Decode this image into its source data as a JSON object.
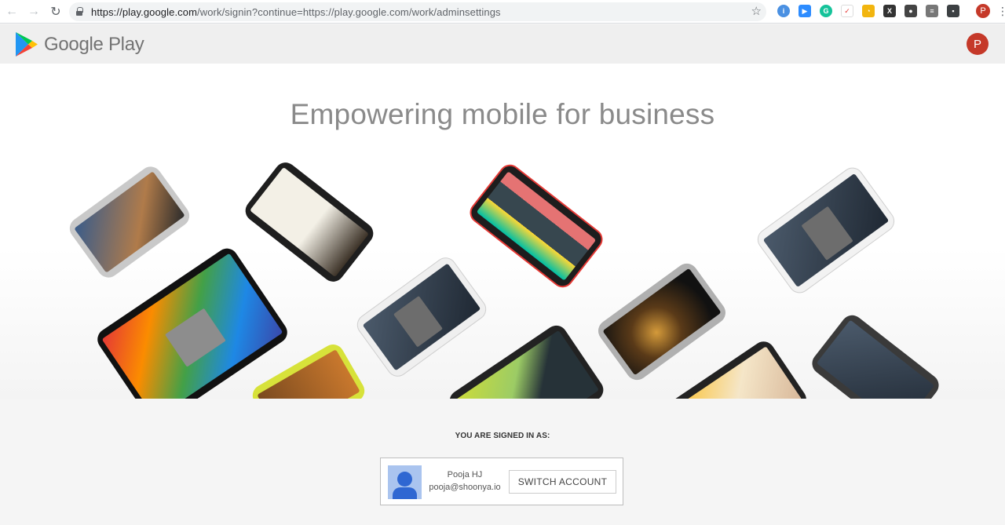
{
  "browser": {
    "url_host": "https://play.google.com",
    "url_path": "/work/signin?continue=https://play.google.com/work/adminsettings",
    "profile_initial": "P",
    "extensions": [
      {
        "icon": "info-extension-icon",
        "color": "#4a90e2",
        "glyph": "i"
      },
      {
        "icon": "zoom-extension-icon",
        "color": "#2d8cff",
        "glyph": "▶"
      },
      {
        "icon": "grammarly-extension-icon",
        "color": "#15c39a",
        "glyph": "G"
      },
      {
        "icon": "todo-extension-icon",
        "color": "#ffffff",
        "glyph": "✓"
      },
      {
        "icon": "clock-extension-icon",
        "color": "#f2b50f",
        "glyph": "◔"
      },
      {
        "icon": "x-extension-icon",
        "color": "#333333",
        "glyph": "X"
      },
      {
        "icon": "dark-extension-icon",
        "color": "#444444",
        "glyph": "●"
      },
      {
        "icon": "doc-extension-icon",
        "color": "#777777",
        "glyph": "≡"
      },
      {
        "icon": "terminal-extension-icon",
        "color": "#3c4043",
        "glyph": "▪"
      }
    ]
  },
  "header": {
    "brand": "Google Play",
    "user_initial": "P"
  },
  "hero": {
    "headline": "Empowering mobile for business"
  },
  "signin": {
    "label": "YOU ARE SIGNED IN AS:",
    "name": "Pooja HJ",
    "email": "pooja@shoonya.io",
    "switch_label": "SWITCH ACCOUNT"
  },
  "colors": {
    "accent_red": "#c53929",
    "avatar_blue": "#2f67d2"
  }
}
